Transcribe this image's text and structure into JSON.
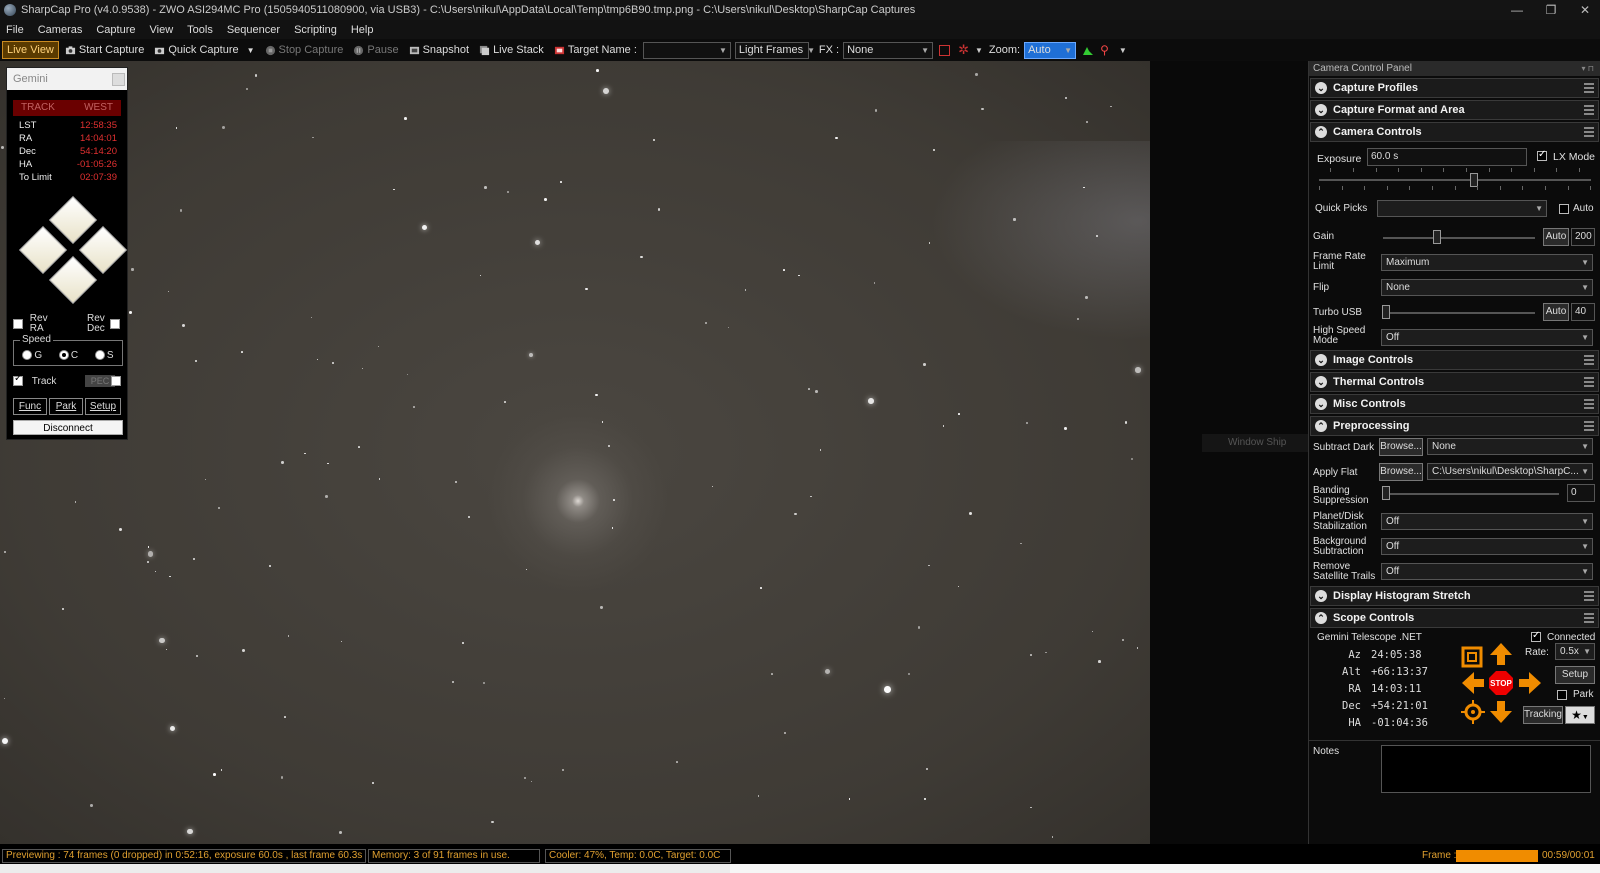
{
  "window": {
    "title": "SharpCap Pro (v4.0.9538) - ZWO ASI294MC Pro (1505940511080900, via USB3) - C:\\Users\\nikul\\AppData\\Local\\Temp\\tmp6B90.tmp.png - C:\\Users\\nikul\\Desktop\\SharpCap Captures",
    "minimize": "—",
    "restore": "❐",
    "close": "✕"
  },
  "menu": [
    "File",
    "Cameras",
    "Capture",
    "View",
    "Tools",
    "Sequencer",
    "Scripting",
    "Help"
  ],
  "toolbar": {
    "live_view": "Live View",
    "start_capture": "Start Capture",
    "quick_capture": "Quick Capture",
    "stop_capture": "Stop Capture",
    "pause": "Pause",
    "snapshot": "Snapshot",
    "live_stack": "Live Stack",
    "target_name_label": "Target Name :",
    "target_name_value": "",
    "frame_type": "Light Frames",
    "fx_label": "FX :",
    "fx_value": "None",
    "zoom_label": "Zoom:",
    "zoom_value": "Auto"
  },
  "gemini": {
    "title": "Gemini",
    "status_left": "TRACK",
    "status_right": "WEST",
    "rows": [
      {
        "k": "LST",
        "v": "12:58:35"
      },
      {
        "k": "RA",
        "v": "14:04:01"
      },
      {
        "k": "Dec",
        "v": "54:14:20"
      },
      {
        "k": "HA",
        "v": "-01:05:26"
      },
      {
        "k": "To Limit",
        "v": "02:07:39"
      }
    ],
    "rev_ra": "Rev RA",
    "rev_dec": "Rev Dec",
    "speed_label": "Speed",
    "speed_g": "G",
    "speed_c": "C",
    "speed_s": "S",
    "track_label": "Track",
    "pec_label": "PEC",
    "func": "Func",
    "park": "Park",
    "setup": "Setup",
    "disconnect": "Disconnect"
  },
  "viewport": {
    "window_ship_label": "Window Ship"
  },
  "panel": {
    "title": "Camera Control Panel",
    "sections": {
      "capture_profiles": "Capture Profiles",
      "capture_format": "Capture Format and Area",
      "camera_controls": "Camera Controls",
      "image_controls": "Image Controls",
      "thermal_controls": "Thermal Controls",
      "misc_controls": "Misc Controls",
      "preprocessing": "Preprocessing",
      "display_histogram": "Display Histogram Stretch",
      "scope_controls": "Scope Controls"
    },
    "camera": {
      "exposure_label": "Exposure",
      "exposure_value": "60.0 s",
      "lx_mode": "LX Mode",
      "quick_picks_label": "Quick Picks",
      "quick_picks_auto": "Auto",
      "gain_label": "Gain",
      "gain_auto": "Auto",
      "gain_value": "200",
      "frame_rate_label": "Frame Rate Limit",
      "frame_rate_value": "Maximum",
      "flip_label": "Flip",
      "flip_value": "None",
      "turbo_label": "Turbo USB",
      "turbo_auto": "Auto",
      "turbo_value": "40",
      "high_speed_label": "High Speed Mode",
      "high_speed_value": "Off"
    },
    "preprocessing": {
      "subtract_dark_label": "Subtract Dark",
      "browse": "Browse...",
      "subtract_dark_value": "None",
      "apply_flat_label": "Apply Flat",
      "apply_flat_value": "C:\\Users\\nikul\\Desktop\\SharpC...",
      "banding_label": "Banding Suppression",
      "banding_value": "0",
      "planet_label": "Planet/Disk Stabilization",
      "planet_value": "Off",
      "background_label": "Background Subtraction",
      "background_value": "Off",
      "satellite_label": "Remove Satellite Trails",
      "satellite_value": "Off"
    },
    "scope": {
      "name": "Gemini Telescope .NET",
      "connected": "Connected",
      "coords": [
        {
          "k": "Az",
          "v": "24:05:38"
        },
        {
          "k": "Alt",
          "v": "+66:13:37"
        },
        {
          "k": "RA",
          "v": "14:03:11"
        },
        {
          "k": "Dec",
          "v": "+54:21:01"
        },
        {
          "k": "HA",
          "v": "-01:04:36"
        }
      ],
      "rate_label": "Rate:",
      "rate_value": "0.5x",
      "setup": "Setup",
      "park": "Park",
      "stop": "STOP",
      "tracking": "Tracking"
    },
    "notes_label": "Notes"
  },
  "status": {
    "preview": "Previewing : 74 frames (0 dropped) in 0:52:16, exposure 60.0s , last frame 60.3s",
    "memory": "Memory: 3 of 91 frames in use.",
    "cooler": "Cooler: 47%, Temp: 0.0C, Target: 0.0C",
    "frame_label": "Frame :",
    "frame_progress": 1.0,
    "frame_time": "00:59/00:01"
  },
  "colors": {
    "accent_orange": "#f08c00",
    "red_readout": "#e03030",
    "sky": "#433f39"
  }
}
